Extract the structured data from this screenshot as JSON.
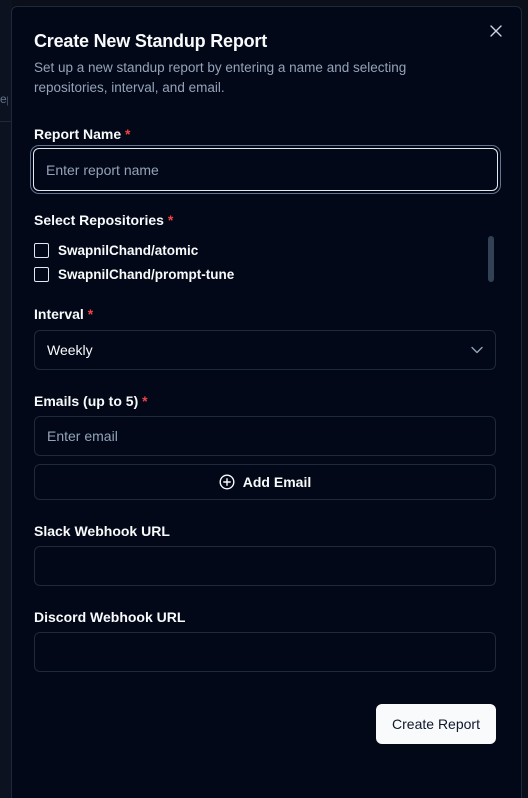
{
  "backdrop": {
    "fragment": "epo"
  },
  "dialog": {
    "title": "Create New Standup Report",
    "subtitle": "Set up a new standup report by entering a name and selecting repositories, interval, and email.",
    "close_icon": "close-icon"
  },
  "report_name": {
    "label": "Report Name",
    "required": "*",
    "placeholder": "Enter report name",
    "value": ""
  },
  "repositories": {
    "label": "Select Repositories",
    "required": "*",
    "items": [
      {
        "label": "SwapnilChand/atomic",
        "checked": false
      },
      {
        "label": "SwapnilChand/prompt-tune",
        "checked": false
      }
    ]
  },
  "interval": {
    "label": "Interval",
    "required": "*",
    "value": "Weekly",
    "icon": "chevron-down-icon"
  },
  "emails": {
    "label": "Emails (up to 5)",
    "required": "*",
    "placeholder": "Enter email",
    "value": "",
    "add_label": "Add Email",
    "add_icon": "plus-circle-icon"
  },
  "slack": {
    "label": "Slack Webhook URL",
    "value": ""
  },
  "discord": {
    "label": "Discord Webhook URL",
    "value": ""
  },
  "submit": {
    "label": "Create Report"
  },
  "colors": {
    "background": "#020817",
    "border": "#1e293b",
    "muted_text": "#94a3b8",
    "required": "#ef4444",
    "primary_button": "#f8fafc"
  }
}
